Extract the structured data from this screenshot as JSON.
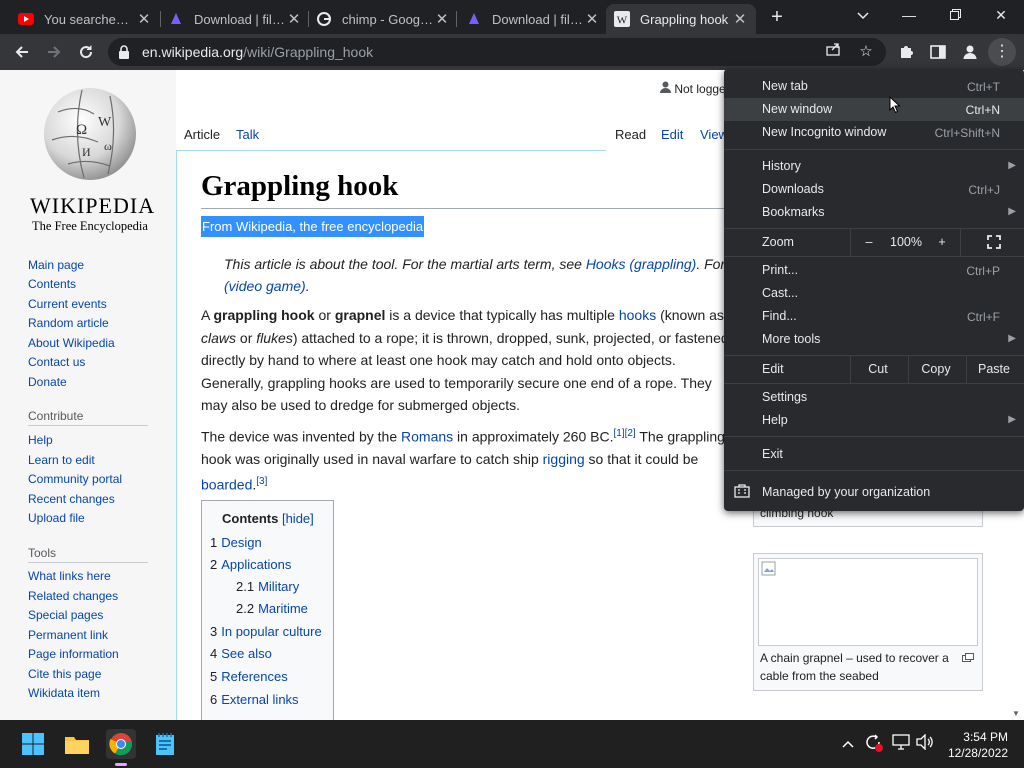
{
  "browser": {
    "tabs": [
      {
        "title": "You searched for",
        "favicon": "youtube-icon",
        "active": false
      },
      {
        "title": "Download | file.io",
        "favicon": "fileio-icon",
        "active": false
      },
      {
        "title": "chimp - Google Se",
        "favicon": "google-icon",
        "active": false
      },
      {
        "title": "Download | file.io",
        "favicon": "fileio-icon",
        "active": false
      },
      {
        "title": "Grappling hook",
        "favicon": "wikipedia-icon",
        "active": true
      }
    ],
    "address_host": "en.wikipedia.org",
    "address_path": "/wiki/Grappling_hook"
  },
  "sidebar": {
    "wordmark": "WIKIPEDIA",
    "tagline": "The Free Encyclopedia",
    "main_links": [
      "Main page",
      "Contents",
      "Current events",
      "Random article",
      "About Wikipedia",
      "Contact us",
      "Donate"
    ],
    "contribute_heading": "Contribute",
    "contribute_links": [
      "Help",
      "Learn to edit",
      "Community portal",
      "Recent changes",
      "Upload file"
    ],
    "tools_heading": "Tools",
    "tools_links": [
      "What links here",
      "Related changes",
      "Special pages",
      "Permanent link",
      "Page information",
      "Cite this page",
      "Wikidata item"
    ]
  },
  "page_tabs": {
    "article": "Article",
    "talk": "Talk",
    "read": "Read",
    "edit": "Edit",
    "view": "View"
  },
  "user_status": "Not logged",
  "article": {
    "title": "Grappling hook",
    "subtitle": "From Wikipedia, the free encyclopedia",
    "hatnote_prefix": "This article is about the tool. For the martial arts term, see ",
    "hatnote_link": "Hooks (grappling)",
    "hatnote_mid": ". For",
    "hatnote_link2": "(video game)",
    "hatnote_end": ".",
    "p1": {
      "a": "A ",
      "b1": "grappling hook",
      "c": " or ",
      "b2": "grapnel",
      "d": " is a device that typically has multiple ",
      "link": "hooks",
      "e": " (known as",
      "l2_i1": "claws",
      "l2_a": " or ",
      "l2_i2": "flukes",
      "l2_b": ") attached to a rope; it is thrown, dropped, sunk, projected, or fastened",
      "l3": "directly by hand to where at least one hook may catch and hold onto objects.",
      "l4": "Generally, grappling hooks are used to temporarily secure one end of a rope. They",
      "l5": "may also be used to dredge for submerged objects."
    },
    "p2": {
      "a": "The device was invented by the ",
      "link1": "Romans",
      "b": " in approximately 260 BC.",
      "ref1": "[1]",
      "ref2": "[2]",
      "c": " The grappling",
      "l2_a": "hook was originally used in naval warfare to catch ship ",
      "link2": "rigging",
      "l2_b": " so that it could be",
      "link3": "boarded",
      "l3_b": ".",
      "ref3": "[3]"
    }
  },
  "toc": {
    "title": "Contents",
    "hide": "[hide]",
    "items": [
      {
        "num": "1",
        "label": "Design"
      },
      {
        "num": "2",
        "label": "Applications"
      },
      {
        "num": "2.1",
        "label": "Military"
      },
      {
        "num": "2.2",
        "label": "Maritime"
      },
      {
        "num": "3",
        "label": "In popular culture"
      },
      {
        "num": "4",
        "label": "See also"
      },
      {
        "num": "5",
        "label": "References"
      },
      {
        "num": "6",
        "label": "External links"
      }
    ]
  },
  "thumbs": {
    "top_caption": "climbing hook",
    "bottom_caption_1": "A chain grapnel – used to recover a",
    "bottom_caption_2": "cable from the seabed"
  },
  "menu": {
    "new_tab": "New tab",
    "new_tab_sc": "Ctrl+T",
    "new_window": "New window",
    "new_window_sc": "Ctrl+N",
    "incognito": "New Incognito window",
    "incognito_sc": "Ctrl+Shift+N",
    "history": "History",
    "downloads": "Downloads",
    "downloads_sc": "Ctrl+J",
    "bookmarks": "Bookmarks",
    "zoom": "Zoom",
    "zoom_minus": "–",
    "zoom_value": "100%",
    "zoom_plus": "+",
    "print": "Print...",
    "print_sc": "Ctrl+P",
    "cast": "Cast...",
    "find": "Find...",
    "find_sc": "Ctrl+F",
    "more_tools": "More tools",
    "edit": "Edit",
    "cut": "Cut",
    "copy": "Copy",
    "paste": "Paste",
    "settings": "Settings",
    "help": "Help",
    "exit": "Exit",
    "managed": "Managed by your organization"
  },
  "taskbar": {
    "time": "3:54 PM",
    "date": "12/28/2022"
  },
  "colors": {
    "chrome_dark": "#202124",
    "toolbar": "#35363a",
    "wiki_link": "#0645ad",
    "selection": "#3390ff",
    "menu_bg": "#292a2d"
  }
}
